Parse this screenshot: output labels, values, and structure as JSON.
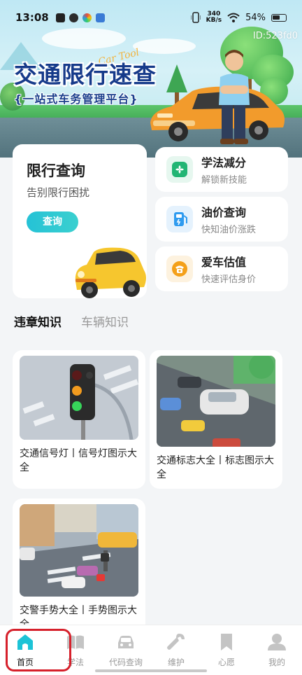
{
  "status_bar": {
    "time": "13:08",
    "net_speed_value": "340",
    "net_speed_unit": "KB/s",
    "battery": "54%"
  },
  "banner": {
    "title": "交通限行速查",
    "subtitle": "{一站式车务管理平台}",
    "id_text": "ID:523fd0"
  },
  "main_card": {
    "title": "限行查询",
    "subtitle": "告别限行困扰",
    "button": "查询"
  },
  "features": [
    {
      "title": "学法减分",
      "subtitle": "解锁新技能",
      "icon": "clover-icon",
      "color": "#22b574"
    },
    {
      "title": "油价查询",
      "subtitle": "快知油价涨跌",
      "icon": "fuel-pump-icon",
      "color": "#2f9bef"
    },
    {
      "title": "爱车估值",
      "subtitle": "快速评估身价",
      "icon": "phone-icon",
      "color": "#f4a019"
    }
  ],
  "tabs": [
    "违章知识",
    "车辆知识"
  ],
  "knowledge": [
    {
      "caption": "交通信号灯丨信号灯图示大全",
      "image": "traffic-light"
    },
    {
      "caption": "交通标志大全丨标志图示大全",
      "image": "road-traffic"
    },
    {
      "caption": "交警手势大全丨手势图示大全",
      "image": "intersection"
    }
  ],
  "bottom_nav": [
    {
      "label": "首页",
      "icon": "home-icon",
      "active": true
    },
    {
      "label": "学法",
      "icon": "book-icon",
      "active": false
    },
    {
      "label": "代码查询",
      "icon": "car-icon",
      "active": false
    },
    {
      "label": "维护",
      "icon": "wrench-icon",
      "active": false
    },
    {
      "label": "心愿",
      "icon": "bookmark-icon",
      "active": false
    },
    {
      "label": "我的",
      "icon": "user-icon",
      "active": false
    }
  ],
  "colors": {
    "accent": "#25c2d6",
    "highlight_box": "#d6202b"
  }
}
